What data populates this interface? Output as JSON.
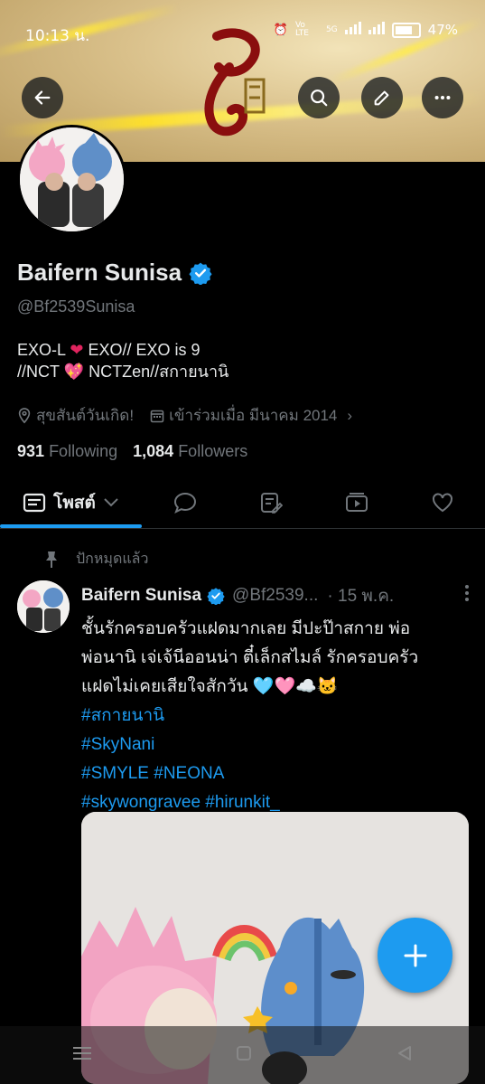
{
  "status_bar": {
    "time": "10:13 น.",
    "network_label": "Vo LTE",
    "signal_label": "5G",
    "battery": "47%"
  },
  "profile": {
    "display_name": "Baifern Sunisa",
    "handle": "@Bf2539Sunisa",
    "bio_line1_a": "EXO-L ",
    "bio_line1_b": " EXO// EXO is 9",
    "bio_line2_a": "//NCT ",
    "bio_line2_b": " NCTZen//สกายนานิ",
    "location": "สุขสันต์วันเกิด!",
    "joined": "เข้าร่วมเมื่อ มีนาคม 2014",
    "following_count": "931",
    "following_label": "Following",
    "followers_count": "1,084",
    "followers_label": "Followers"
  },
  "tabs": {
    "posts_label": "โพสต์"
  },
  "pinned_post": {
    "pinned_label": "ปักหมุดแล้ว",
    "author_name": "Baifern Sunisa",
    "author_handle": "@Bf2539...",
    "date": "· 15 พ.ค.",
    "text_line1": "ชั้นรักครอบครัวแฝดมากเลย มีปะป๊าสกาย พ่อ",
    "text_line2": "พ่อนานิ เจ่เจ้นีออนน่า ตี๋เล็กสไมล์ รักครอบครัว",
    "text_line3": "แฝดไม่เคยเสียใจสักวัน 🩵🩷☁️🐱",
    "hashtags": [
      "#สกายนานิ",
      "#SkyNani",
      "#SMYLE #NEONA",
      "#skywongravee #hirunkit_"
    ]
  },
  "colors": {
    "accent": "#1d9bf0",
    "background": "#000000",
    "text_primary": "#e7e9ea",
    "text_secondary": "#71767b",
    "divider": "#2f3336"
  },
  "icons": {
    "back": "back-arrow-icon",
    "search": "search-icon",
    "edit": "pencil-icon",
    "more": "more-horizontal-icon",
    "verified": "verified-badge-icon",
    "location": "location-pin-icon",
    "calendar": "calendar-icon",
    "pin": "pin-icon",
    "compose": "plus-icon"
  }
}
